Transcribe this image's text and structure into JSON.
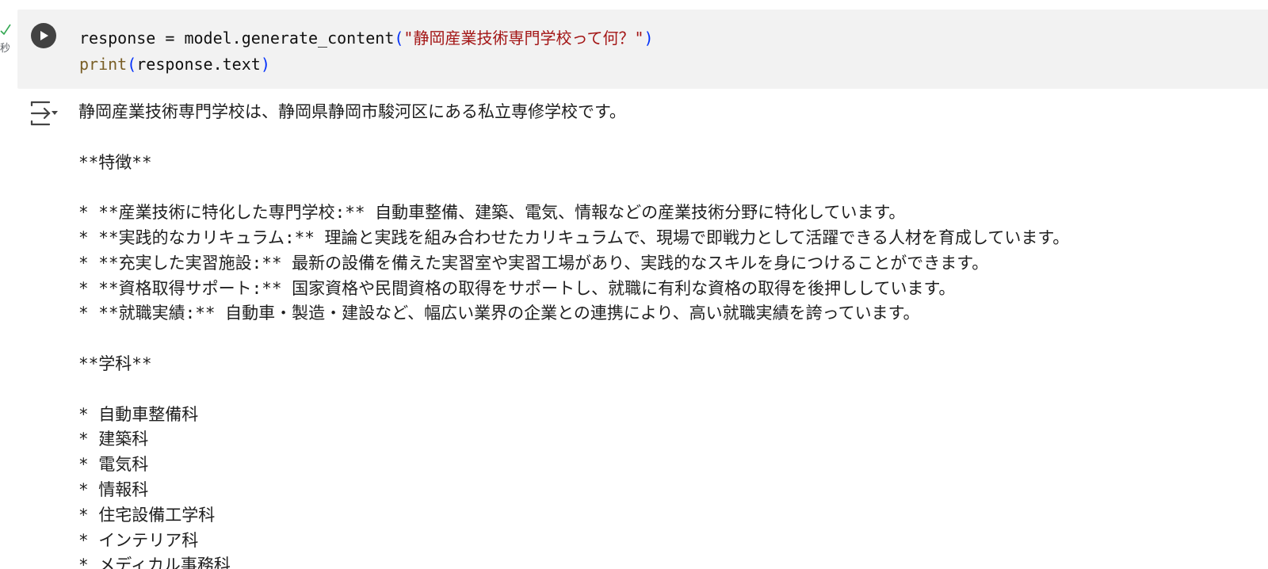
{
  "cell": {
    "exec_time_label": "秒",
    "code": {
      "line1": {
        "var": "response",
        "op": " = ",
        "call": "model.generate_content",
        "open": "(",
        "str": "\"静岡産業技術専門学校って何？\"",
        "close": ")"
      },
      "line2": {
        "fn": "print",
        "open": "(",
        "arg": "response.text",
        "close": ")"
      }
    }
  },
  "output": {
    "intro": "静岡産業技術専門学校は、静岡県静岡市駿河区にある私立専修学校です。",
    "features_heading": "**特徴**",
    "features": [
      "* **産業技術に特化した専門学校:** 自動車整備、建築、電気、情報などの産業技術分野に特化しています。",
      "* **実践的なカリキュラム:** 理論と実践を組み合わせたカリキュラムで、現場で即戦力として活躍できる人材を育成しています。",
      "* **充実した実習施設:** 最新の設備を備えた実習室や実習工場があり、実践的なスキルを身につけることができます。",
      "* **資格取得サポート:** 国家資格や民間資格の取得をサポートし、就職に有利な資格の取得を後押ししています。",
      "* **就職実績:** 自動車・製造・建設など、幅広い業界の企業との連携により、高い就職実績を誇っています。"
    ],
    "departments_heading": "**学科**",
    "departments": [
      "* 自動車整備科",
      "* 建築科",
      "* 電気科",
      "* 情報科",
      "* 住宅設備工学科",
      "* インテリア科",
      "* メディカル事務科"
    ]
  },
  "icons": {
    "run": "play-circle-icon",
    "check": "check-icon",
    "output_toggle": "output-collapse-icon"
  },
  "colors": {
    "cell_bg": "#f2f2f2",
    "run_button": "#424242",
    "string": "#a31515",
    "function": "#795e26",
    "paren": "#0431fa",
    "check": "#34a853"
  }
}
